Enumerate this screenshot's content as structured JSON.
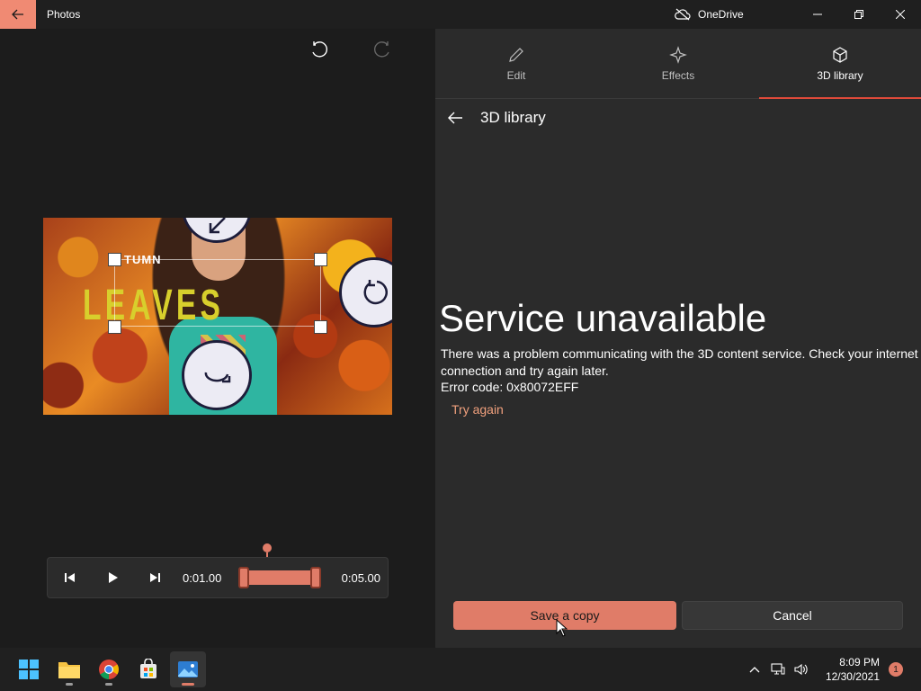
{
  "titlebar": {
    "app_title": "Photos",
    "onedrive_label": "OneDrive"
  },
  "playback": {
    "current_time": "0:01.00",
    "end_time": "0:05.00"
  },
  "preview": {
    "text_top": "TUMN",
    "text_main": "LEAVES"
  },
  "tabs": [
    {
      "label": "Edit",
      "icon": "pencil-icon"
    },
    {
      "label": "Effects",
      "icon": "sparkle-icon"
    },
    {
      "label": "3D library",
      "icon": "cube-icon",
      "active": true
    }
  ],
  "panel": {
    "title": "3D library",
    "error_title": "Service unavailable",
    "error_message": "There was a problem communicating with the 3D content service. Check your internet connection and try again later.",
    "error_code": "Error code: 0x80072EFF",
    "retry_label": "Try again",
    "save_label": "Save a copy",
    "cancel_label": "Cancel"
  },
  "taskbar": {
    "apps": [
      "start-icon",
      "file-explorer-icon",
      "chrome-icon",
      "store-icon",
      "photos-icon"
    ],
    "time": "8:09 PM",
    "date": "12/30/2021",
    "notification_count": "1"
  },
  "colors": {
    "accent": "#e07c68",
    "panel_bg": "#2b2b2b",
    "app_bg": "#1c1c1c",
    "tab_underline": "#e04a3a",
    "link": "#f0a07d"
  }
}
